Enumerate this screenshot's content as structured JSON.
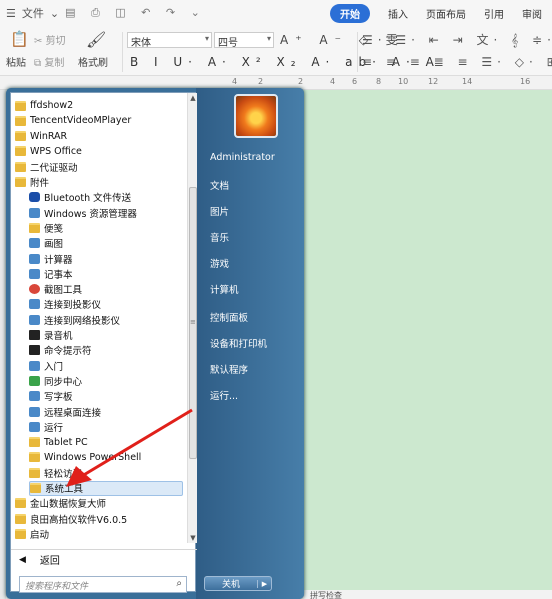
{
  "wps": {
    "menubar": {
      "file": "文件",
      "quick_access_glyphs": "▤ ⎙ ◫ ↶ ↷ ⌄"
    },
    "tabs": [
      {
        "label": "开始",
        "active": true
      },
      {
        "label": "插入",
        "active": false
      },
      {
        "label": "页面布局",
        "active": false
      },
      {
        "label": "引用",
        "active": false
      },
      {
        "label": "审阅",
        "active": false
      }
    ],
    "ribbon": {
      "paste_label": "粘贴",
      "cut_label": "剪切",
      "copy_label": "复制",
      "format_painter_label": "格式刷",
      "font_name": "宋体",
      "font_size": "四号",
      "row1_glyphs": "A⁺ A⁻ ◇ 雯",
      "row2_glyphs": "B I U· A· X² X₂ A· ab· A· A",
      "para_row1_glyphs": "☰· ☰· ⇤ ⇥ 文· 𝄞 ≑· ⊞",
      "para_row2_glyphs": "≡ ≡ ≡ ≣ ≡ ☰· ◇· ⊞·"
    },
    "ruler_marks": [
      "4",
      "2",
      "2",
      "4",
      "6",
      "8",
      "10",
      "12",
      "14",
      "16"
    ],
    "status_text": "拼写检查"
  },
  "startmenu": {
    "programs": [
      {
        "label": "ffdshow2",
        "icon": "folder",
        "indent": false
      },
      {
        "label": "TencentVideoMPlayer",
        "icon": "folder",
        "indent": false
      },
      {
        "label": "WinRAR",
        "icon": "folder",
        "indent": false
      },
      {
        "label": "WPS Office",
        "icon": "folder",
        "indent": false
      },
      {
        "label": "二代证驱动",
        "icon": "folder",
        "indent": false
      },
      {
        "label": "附件",
        "icon": "folder",
        "indent": false
      },
      {
        "label": "Bluetooth 文件传送",
        "icon": "bluetooth",
        "indent": true
      },
      {
        "label": "Windows 资源管理器",
        "icon": "app",
        "indent": true
      },
      {
        "label": "便笺",
        "icon": "note",
        "indent": true
      },
      {
        "label": "画图",
        "icon": "paint",
        "indent": true
      },
      {
        "label": "计算器",
        "icon": "app",
        "indent": true
      },
      {
        "label": "记事本",
        "icon": "app",
        "indent": true
      },
      {
        "label": "截图工具",
        "icon": "red",
        "indent": true
      },
      {
        "label": "连接到投影仪",
        "icon": "app",
        "indent": true
      },
      {
        "label": "连接到网络投影仪",
        "icon": "app",
        "indent": true
      },
      {
        "label": "录音机",
        "icon": "mic",
        "indent": true
      },
      {
        "label": "命令提示符",
        "icon": "cmd",
        "indent": true
      },
      {
        "label": "入门",
        "icon": "app",
        "indent": true
      },
      {
        "label": "同步中心",
        "icon": "green",
        "indent": true
      },
      {
        "label": "写字板",
        "icon": "app",
        "indent": true
      },
      {
        "label": "远程桌面连接",
        "icon": "app",
        "indent": true
      },
      {
        "label": "运行",
        "icon": "app",
        "indent": true
      },
      {
        "label": "Tablet PC",
        "icon": "folder",
        "indent": true
      },
      {
        "label": "Windows PowerShell",
        "icon": "folder",
        "indent": true
      },
      {
        "label": "轻松访问",
        "icon": "folder",
        "indent": true
      },
      {
        "label": "系统工具",
        "icon": "folder",
        "indent": true,
        "highlighted": true
      },
      {
        "label": "金山数据恢复大师",
        "icon": "folder",
        "indent": false
      },
      {
        "label": "良田高拍仪软件V6.0.5",
        "icon": "folder",
        "indent": false
      },
      {
        "label": "启动",
        "icon": "folder",
        "indent": false
      }
    ],
    "back_label": "返回",
    "search_placeholder": "搜索程序和文件",
    "right_links": [
      {
        "label": "Administrator"
      },
      {
        "label": "文档"
      },
      {
        "label": "图片"
      },
      {
        "label": "音乐"
      },
      {
        "label": "游戏"
      },
      {
        "label": "计算机"
      },
      {
        "label": "控制面板"
      },
      {
        "label": "设备和打印机"
      },
      {
        "label": "默认程序"
      },
      {
        "label": "运行..."
      }
    ],
    "shutdown_label": "关机"
  },
  "colors": {
    "accent": "#2b6fd6",
    "doc_background": "#cce8cf",
    "startmenu_blue": "#3a6f99",
    "annotation_arrow": "#e0201a"
  }
}
